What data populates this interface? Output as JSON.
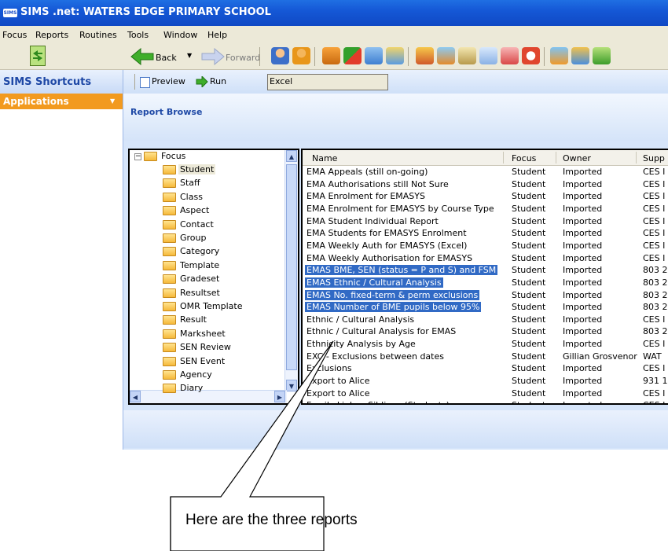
{
  "window": {
    "title": "SIMS .net: WATERS EDGE PRIMARY SCHOOL",
    "app_badge": "SIMS"
  },
  "menu": [
    "Focus",
    "Reports",
    "Routines",
    "Tools",
    "Window",
    "Help"
  ],
  "toolbar": {
    "back": "Back",
    "forward": "Forward"
  },
  "sidebar": {
    "title": "SIMS Shortcuts",
    "section": "Applications"
  },
  "actions": {
    "preview": "Preview",
    "run": "Run",
    "tooltip": "Excel"
  },
  "pane": {
    "title": "Report Browse"
  },
  "tree": {
    "root": "Focus",
    "items": [
      "Student",
      "Staff",
      "Class",
      "Aspect",
      "Contact",
      "Group",
      "Category",
      "Template",
      "Gradeset",
      "Resultset",
      "OMR Template",
      "Result",
      "Marksheet",
      "SEN Review",
      "SEN Event",
      "Agency",
      "Diary"
    ]
  },
  "list": {
    "columns": [
      "Name",
      "Focus",
      "Owner",
      "Supp"
    ],
    "rows": [
      {
        "name": "EMA Appeals (still on-going)",
        "focus": "Student",
        "owner": "Imported",
        "supp": "CES I"
      },
      {
        "name": "EMA Authorisations still Not Sure",
        "focus": "Student",
        "owner": "Imported",
        "supp": "CES I"
      },
      {
        "name": "EMA Enrolment for EMASYS",
        "focus": "Student",
        "owner": "Imported",
        "supp": "CES I"
      },
      {
        "name": "EMA Enrolment for EMASYS by Course Type",
        "focus": "Student",
        "owner": "Imported",
        "supp": "CES I"
      },
      {
        "name": "EMA Student Individual Report",
        "focus": "Student",
        "owner": "Imported",
        "supp": "CES I"
      },
      {
        "name": "EMA Students for EMASYS Enrolment",
        "focus": "Student",
        "owner": "Imported",
        "supp": "CES I"
      },
      {
        "name": "EMA Weekly Auth for EMASYS (Excel)",
        "focus": "Student",
        "owner": "Imported",
        "supp": "CES I"
      },
      {
        "name": "EMA Weekly Authorisation for EMASYS",
        "focus": "Student",
        "owner": "Imported",
        "supp": "CES I"
      },
      {
        "name": "EMAS BME, SEN (status = P and S) and FSM",
        "focus": "Student",
        "owner": "Imported",
        "supp": "803 2"
      },
      {
        "name": "EMAS Ethnic / Cultural Analysis",
        "focus": "Student",
        "owner": "Imported",
        "supp": "803 2"
      },
      {
        "name": "EMAS No. fixed-term & perm exclusions",
        "focus": "Student",
        "owner": "Imported",
        "supp": "803 2"
      },
      {
        "name": "EMAS Number of BME pupils below 95%",
        "focus": "Student",
        "owner": "Imported",
        "supp": "803 2"
      },
      {
        "name": "Ethnic / Cultural Analysis",
        "focus": "Student",
        "owner": "Imported",
        "supp": "CES I"
      },
      {
        "name": "Ethnic / Cultural Analysis for EMAS",
        "focus": "Student",
        "owner": "Imported",
        "supp": "803 2"
      },
      {
        "name": "Ethnicity Analysis by Age",
        "focus": "Student",
        "owner": "Imported",
        "supp": "CES I"
      },
      {
        "name": "EXC - Exclusions between dates",
        "focus": "Student",
        "owner": "Gillian Grosvenor",
        "supp": "WAT"
      },
      {
        "name": "Exclusions",
        "focus": "Student",
        "owner": "Imported",
        "supp": "CES I"
      },
      {
        "name": "Export to Alice",
        "focus": "Student",
        "owner": "Imported",
        "supp": "931 1"
      },
      {
        "name": "Export to Alice",
        "focus": "Student",
        "owner": "Imported",
        "supp": "CES I"
      },
      {
        "name": "Family Links - Siblings (Students)",
        "focus": "Student",
        "owner": "Imported",
        "supp": "CES I"
      }
    ],
    "selected_rows": [
      8,
      9,
      10,
      11
    ]
  },
  "callout": {
    "text": "Here are the three reports"
  },
  "colors": {
    "title_blue": "#1558d6",
    "selection": "#316ac5",
    "accent_orange": "#f29a1f"
  },
  "icons": [
    "focus-switch-icon",
    "back-arrow-icon",
    "forward-arrow-icon",
    "student-icon",
    "staff-icon",
    "report-icon",
    "flag-icon",
    "people-icon",
    "run-icon",
    "preview-icon",
    "folder-icon"
  ]
}
